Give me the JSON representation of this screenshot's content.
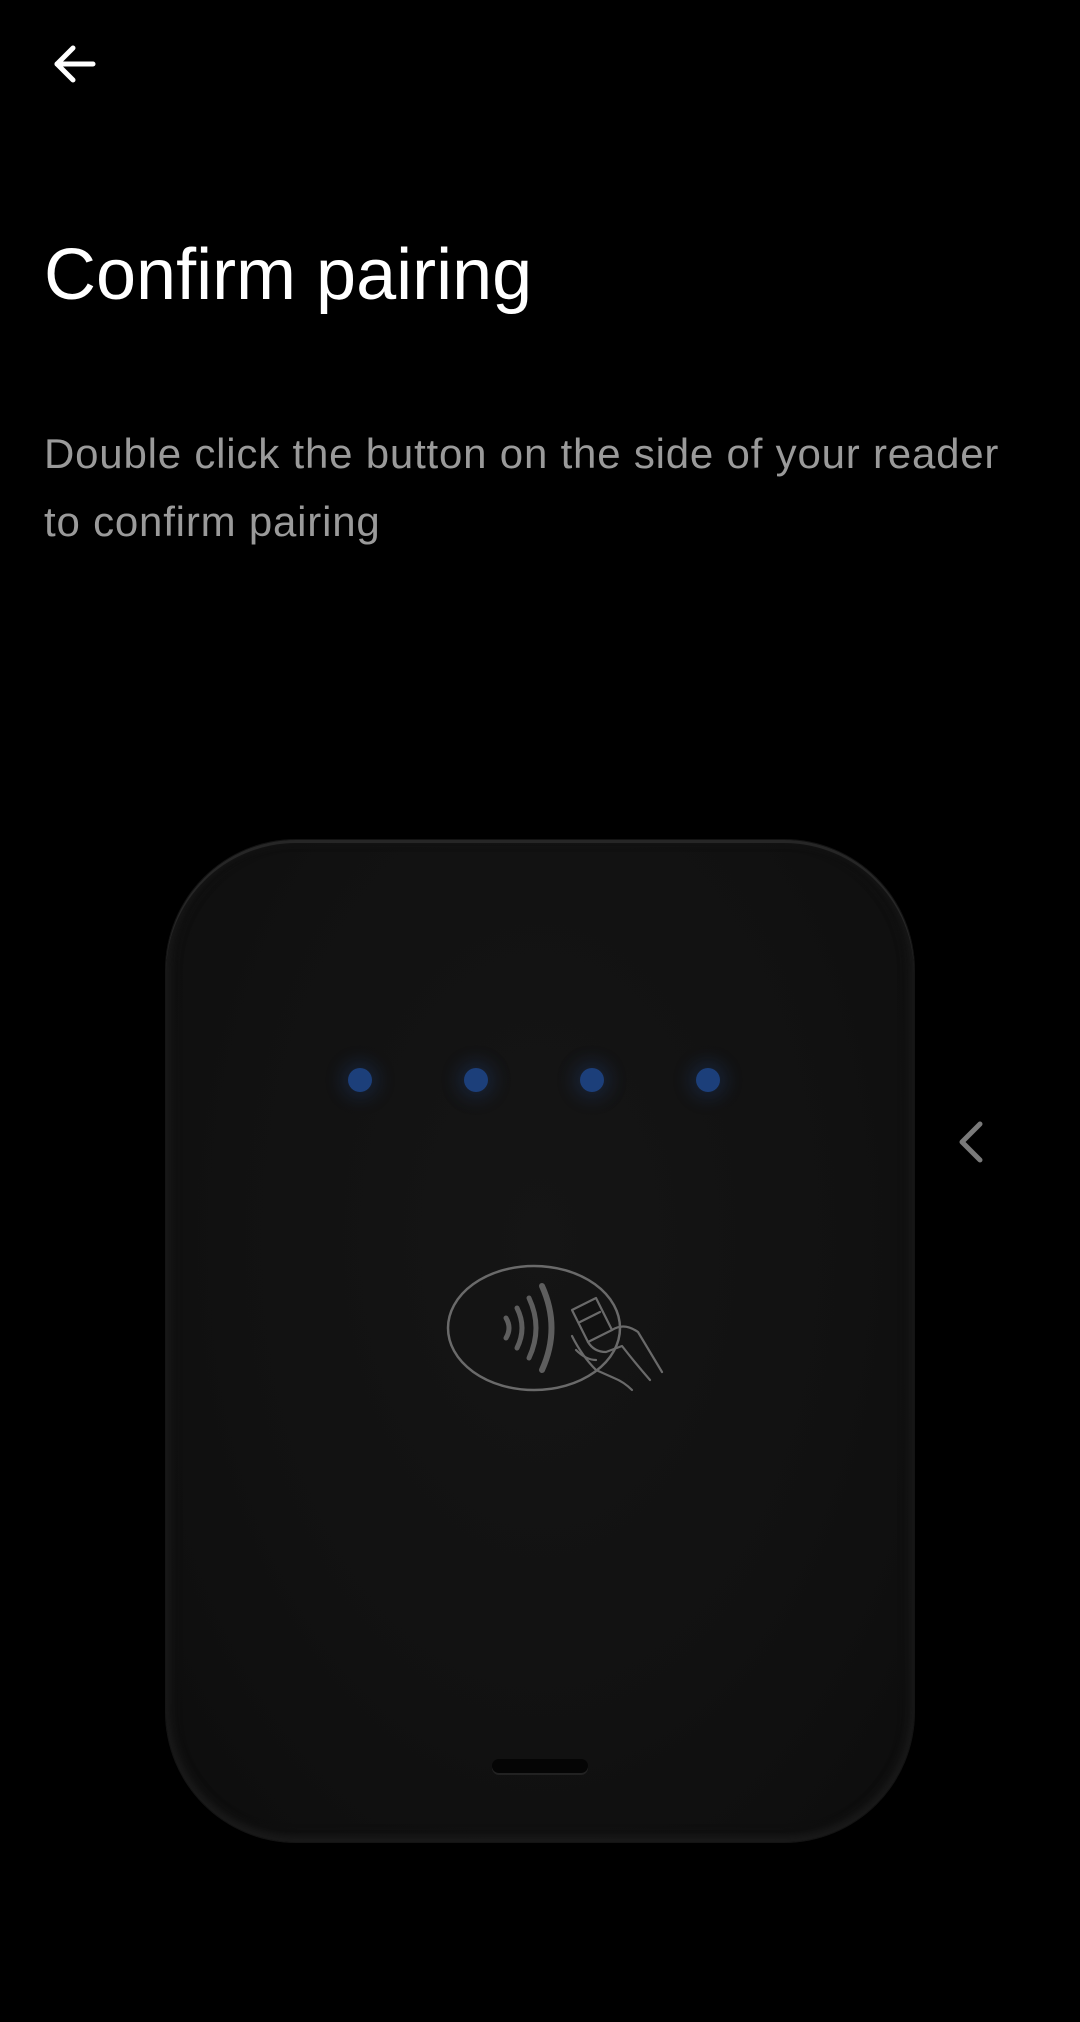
{
  "header": {
    "back_icon": "arrow-left-icon"
  },
  "page": {
    "title": "Confirm pairing",
    "description": "Double click the button on the side of your reader to confirm pairing"
  },
  "illustration": {
    "device": "card-reader",
    "led_count": 4,
    "led_color": "#1c3f7a",
    "body_color": "#111111",
    "center_icon": "contactless-payment-icon"
  },
  "carousel": {
    "prev_icon": "chevron-left-icon"
  },
  "colors": {
    "background": "#000000",
    "title": "#ffffff",
    "description": "#9a9a9a"
  }
}
